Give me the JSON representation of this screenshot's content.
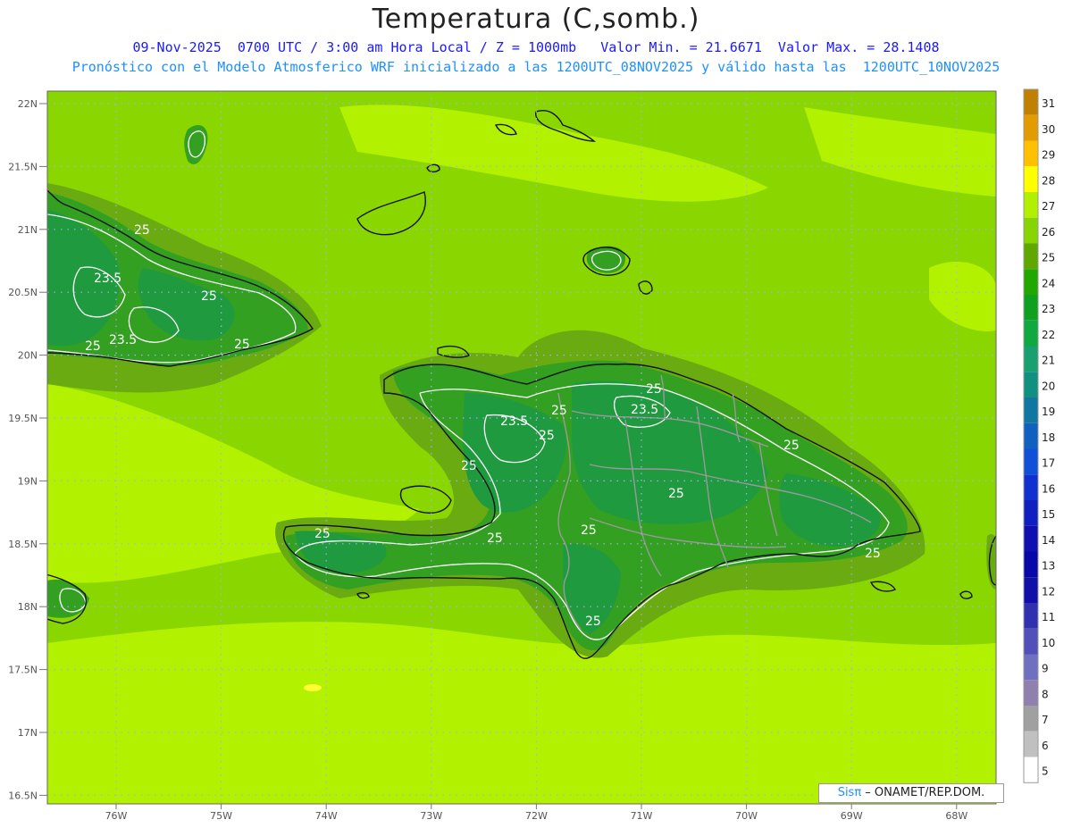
{
  "header": {
    "title": "Temperatura (C,somb.)",
    "subtitle_line1": "09-Nov-2025  0700 UTC / 3:00 am Hora Local / Z = 1000mb   Valor Min. = 21.6671  Valor Max. = 28.1408",
    "subtitle_line2": "Pronóstico con el Modelo Atmosferico WRF inicializado a las 1200UTC_08NOV2025 y válido hasta las  1200UTC_10NOV2025"
  },
  "map": {
    "lat_labels": [
      "22N",
      "21.5N",
      "21N",
      "20.5N",
      "20N",
      "19.5N",
      "19N",
      "18.5N",
      "18N",
      "17.5N",
      "17N",
      "16.5N"
    ],
    "lon_labels": [
      "76W",
      "75W",
      "74W",
      "73W",
      "72W",
      "71W",
      "70W",
      "69W",
      "68W"
    ],
    "contour_labels": [
      {
        "text": "25"
      },
      {
        "text": "23.5"
      },
      {
        "text": "25"
      },
      {
        "text": "25"
      },
      {
        "text": "23.5"
      },
      {
        "text": "25"
      },
      {
        "text": "25"
      },
      {
        "text": "23.5"
      },
      {
        "text": "25"
      },
      {
        "text": "23.5"
      },
      {
        "text": "25"
      },
      {
        "text": "25"
      },
      {
        "text": "25"
      },
      {
        "text": "25"
      },
      {
        "text": "25"
      },
      {
        "text": "25"
      },
      {
        "text": "25"
      },
      {
        "text": "25"
      },
      {
        "text": "25"
      },
      {
        "text": "25"
      },
      {
        "text": "25"
      }
    ],
    "colors": {
      "sea_base": "#8ad600",
      "warm_band": "#b2f200",
      "land_low": "#6aab12",
      "land_mid": "#34a022",
      "land_core": "#1f9a3e",
      "coast": "#111111",
      "border": "#999999",
      "contour": "#ffffff",
      "grid": "#aaaaff"
    }
  },
  "colorbar": {
    "labels": [
      "31",
      "30",
      "29",
      "28",
      "27",
      "26",
      "25",
      "24",
      "23",
      "22",
      "21",
      "20",
      "19",
      "18",
      "17",
      "16",
      "15",
      "14",
      "13",
      "12",
      "11",
      "10",
      "9",
      "8",
      "7",
      "6",
      "5"
    ],
    "colors": [
      "#c08000",
      "#e39b00",
      "#ffc000",
      "#ffff00",
      "#b0f000",
      "#88d400",
      "#60a800",
      "#20a800",
      "#10a020",
      "#10a840",
      "#18a070",
      "#109080",
      "#1078a0",
      "#1060c0",
      "#1050d8",
      "#1030d0",
      "#1020c0",
      "#1010b0",
      "#0808a8",
      "#1010a8",
      "#3030b0",
      "#5050b8",
      "#7070c0",
      "#9080b0",
      "#a0a0a0",
      "#c0c0c0",
      "#ffffff"
    ]
  },
  "credit": {
    "brand": "Sisπ",
    "text": " – ONAMET/REP.DOM."
  }
}
